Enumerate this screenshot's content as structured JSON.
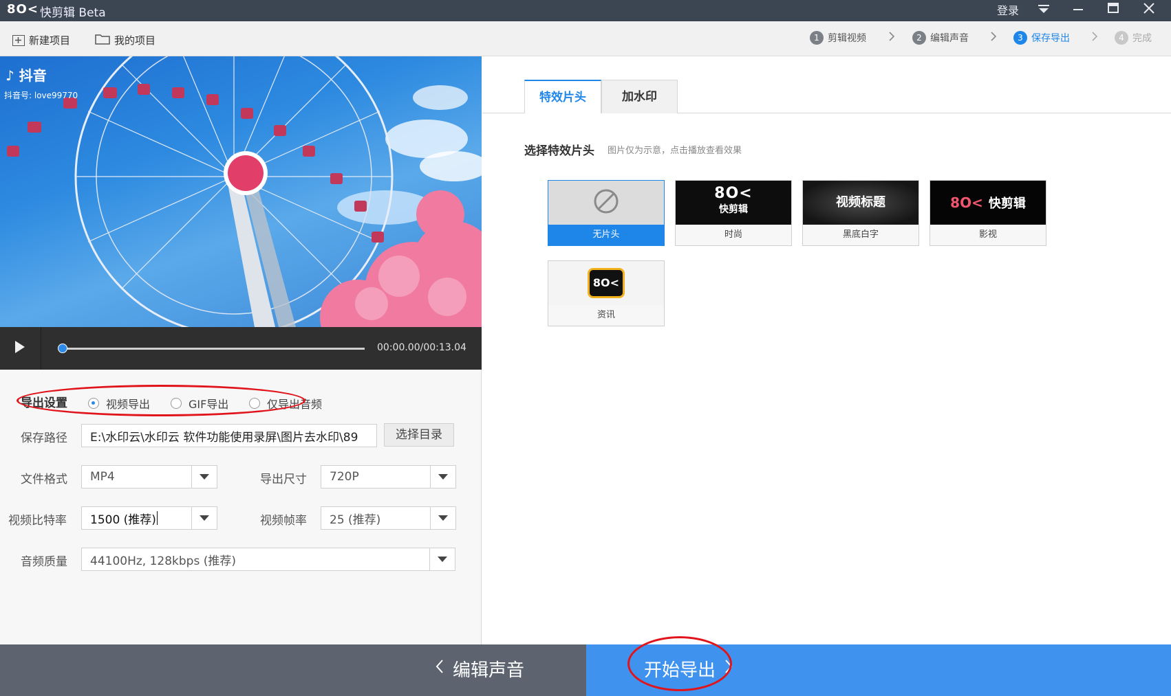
{
  "window": {
    "logo": "8O<",
    "title": "快剪辑 Beta",
    "login_label": "登录",
    "menu_icon": "menu-down-icon",
    "minimize_icon": "minimize-icon",
    "maximize_icon": "maximize-icon",
    "close_icon": "close-icon"
  },
  "toolbar": {
    "new_project": "新建项目",
    "my_projects": "我的项目"
  },
  "steps": [
    {
      "num": "1",
      "label": "剪辑视频",
      "state": "normal"
    },
    {
      "num": "2",
      "label": "编辑声音",
      "state": "normal"
    },
    {
      "num": "3",
      "label": "保存导出",
      "state": "active"
    },
    {
      "num": "4",
      "label": "完成",
      "state": "disabled"
    }
  ],
  "video": {
    "brand": "抖音",
    "account": "抖音号: love99770",
    "time": "00:00.00/00:13.04",
    "progress": 0.0
  },
  "export": {
    "section_label": "导出设置",
    "modes": [
      {
        "label": "视频导出",
        "checked": true
      },
      {
        "label": "GIF导出",
        "checked": false
      },
      {
        "label": "仅导出音频",
        "checked": false
      }
    ],
    "path_label": "保存路径",
    "path_value": "E:\\水印云\\水印云 软件功能使用录屏\\图片去水印\\89",
    "choose_dir": "选择目录",
    "format_label": "文件格式",
    "format_value": "MP4",
    "size_label": "导出尺寸",
    "size_value": "720P",
    "bitrate_label": "视频比特率",
    "bitrate_value": "1500 (推荐)",
    "fps_label": "视频帧率",
    "fps_value": "25 (推荐)",
    "audio_label": "音频质量",
    "audio_value": "44100Hz, 128kbps (推荐)"
  },
  "right": {
    "tabs": [
      {
        "label": "特效片头",
        "active": true
      },
      {
        "label": "加水印",
        "active": false
      }
    ],
    "section_title": "选择特效片头",
    "section_hint": "图片仅为示意，点击播放查看效果",
    "intros": [
      {
        "label": "无片头",
        "selected": true
      },
      {
        "label": "时尚",
        "selected": false,
        "thumb_logo": "8O<",
        "thumb_text": "快剪辑"
      },
      {
        "label": "黑底白字",
        "selected": false,
        "thumb_text": "视频标题"
      },
      {
        "label": "影视",
        "selected": false,
        "thumb_logo": "8O<",
        "thumb_text": "快剪辑"
      },
      {
        "label": "资讯",
        "selected": false,
        "thumb_logo": "8O<"
      }
    ]
  },
  "bottom": {
    "back_label": "编辑声音",
    "export_label": "开始导出"
  },
  "colors": {
    "accent": "#1e86e8",
    "annotation": "#e0141a",
    "titlebar": "#3c4552"
  }
}
